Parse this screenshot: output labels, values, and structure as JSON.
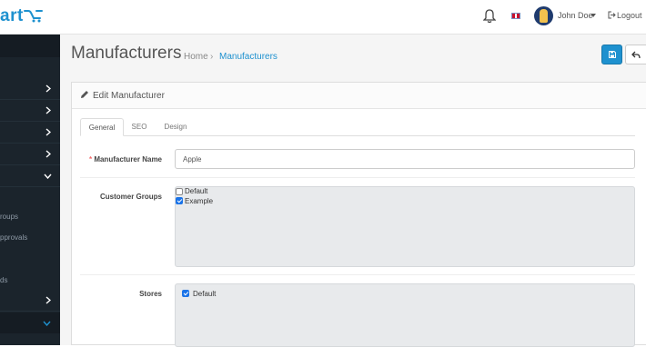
{
  "header": {
    "logo_text": "art",
    "user_name": "John Doe",
    "logout_label": "Logout"
  },
  "sidebar": {
    "partial_labels": [
      "roups",
      "pprovals",
      "ds"
    ]
  },
  "page": {
    "title": "Manufacturers",
    "breadcrumb": [
      "Home",
      "Manufacturers"
    ],
    "breadcrumb_separator": "›"
  },
  "panel": {
    "heading": "Edit Manufacturer",
    "tabs": [
      {
        "label": "General",
        "active": true
      },
      {
        "label": "SEO",
        "active": false
      },
      {
        "label": "Design",
        "active": false
      }
    ]
  },
  "form": {
    "name_label": "Manufacturer Name",
    "name_required_marker": "*",
    "name_value": "Apple",
    "groups_label": "Customer Groups",
    "groups": [
      {
        "label": "Default",
        "checked": false
      },
      {
        "label": "Example",
        "checked": true
      }
    ],
    "stores_label": "Stores",
    "stores": [
      {
        "label": "Default",
        "checked": true
      }
    ]
  },
  "icons": {
    "bell": "bell-icon",
    "flag": "uk-flag-icon",
    "save": "save-icon",
    "back": "reply-icon",
    "pencil": "pencil-icon",
    "logout": "sign-out-icon"
  },
  "colors": {
    "accent": "#1e91cf",
    "sidebar": "#1b242c",
    "required": "#f56b6b",
    "checkbox": "#1a73e8"
  }
}
